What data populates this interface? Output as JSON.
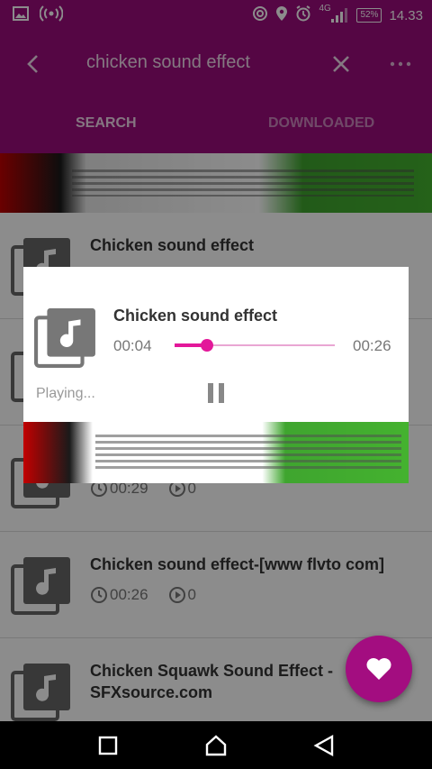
{
  "status_bar": {
    "left_icons": [
      "image-icon",
      "hotspot-icon"
    ],
    "right_icons": [
      "nfc-icon",
      "location-icon",
      "alarm-icon",
      "signal-4g-icon"
    ],
    "network": "4G",
    "battery": "52%",
    "time": "14.33"
  },
  "app_bar": {
    "search_query": "chicken sound effect",
    "tabs": [
      {
        "label": "SEARCH",
        "active": true
      },
      {
        "label": "DOWNLOADED",
        "active": false
      }
    ]
  },
  "results": [
    {
      "title": "Chicken sound effect",
      "duration": "",
      "plays": ""
    },
    {
      "title": "",
      "duration": "",
      "plays": ""
    },
    {
      "title": "",
      "duration": "00:29",
      "plays": "0"
    },
    {
      "title": "Chicken sound effect-[www flvto com]",
      "duration": "00:26",
      "plays": "0"
    },
    {
      "title": "Chicken Squawk Sound Effect - SFXsource.com",
      "duration": "",
      "plays": ""
    }
  ],
  "player": {
    "title": "Chicken sound effect",
    "current_time": "00:04",
    "total_time": "00:26",
    "progress": 0.2,
    "status": "Playing..."
  },
  "colors": {
    "primary": "#9b0b7c",
    "accent": "#e3189a",
    "fab": "#a30d80"
  },
  "nav": [
    "recent-apps-icon",
    "home-icon",
    "back-icon"
  ]
}
